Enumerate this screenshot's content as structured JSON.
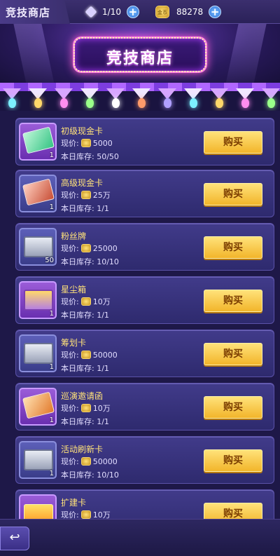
{
  "topbar": {
    "title": "竞技商店",
    "gems": "1/10",
    "coins": "88278",
    "coin_badge": "金币"
  },
  "header": {
    "sign_text": "竞技商店"
  },
  "labels": {
    "price_prefix": "现价:",
    "stock_prefix": "本日库存:",
    "buy": "购买"
  },
  "items": [
    {
      "name": "初级现金卡",
      "price": "5000",
      "stock": "50/50",
      "qty": "1",
      "art": "card-green",
      "slot": "purple"
    },
    {
      "name": "高级现金卡",
      "price": "25万",
      "stock": "1/1",
      "qty": "1",
      "art": "card-red",
      "slot": "blue"
    },
    {
      "name": "粉丝牌",
      "price": "25000",
      "stock": "10/10",
      "qty": "50",
      "art": "chest",
      "slot": "blue"
    },
    {
      "name": "星尘箱",
      "price": "10万",
      "stock": "1/1",
      "qty": "1",
      "art": "chest-purple",
      "slot": "purple"
    },
    {
      "name": "筹划卡",
      "price": "50000",
      "stock": "1/1",
      "qty": "1",
      "art": "chest",
      "slot": "blue"
    },
    {
      "name": "巡演邀请函",
      "price": "10万",
      "stock": "1/1",
      "qty": "1",
      "art": "card-orange",
      "slot": "purple"
    },
    {
      "name": "活动刷新卡",
      "price": "50000",
      "stock": "10/10",
      "qty": "1",
      "art": "chest",
      "slot": "blue"
    },
    {
      "name": "扩建卡",
      "price": "10万",
      "stock": "",
      "qty": "",
      "art": "expand",
      "slot": "purple"
    }
  ],
  "bottombar": {
    "back_icon": "↩"
  }
}
